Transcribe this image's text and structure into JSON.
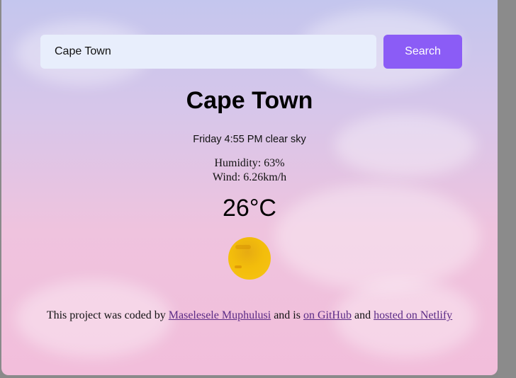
{
  "search": {
    "value": "Cape Town",
    "button_label": "Search"
  },
  "weather": {
    "city": "Cape Town",
    "day_time_description": "Friday 4:55 PM clear sky",
    "humidity": "Humidity: 63%",
    "wind": "Wind: 6.26km/h",
    "temperature": "26°C",
    "icon": "sun-icon"
  },
  "footer": {
    "prefix": "This project was coded by ",
    "author_link": "Maselesele Muphulusi",
    "middle": " and is ",
    "github_link": "on GitHub",
    "connector": " and ",
    "hosted_link": "hosted on Netlify"
  },
  "colors": {
    "accent": "#8b5cf6",
    "input_background": "#e8eefc",
    "link": "#5b2a86",
    "sun": "#f3bd0b"
  }
}
